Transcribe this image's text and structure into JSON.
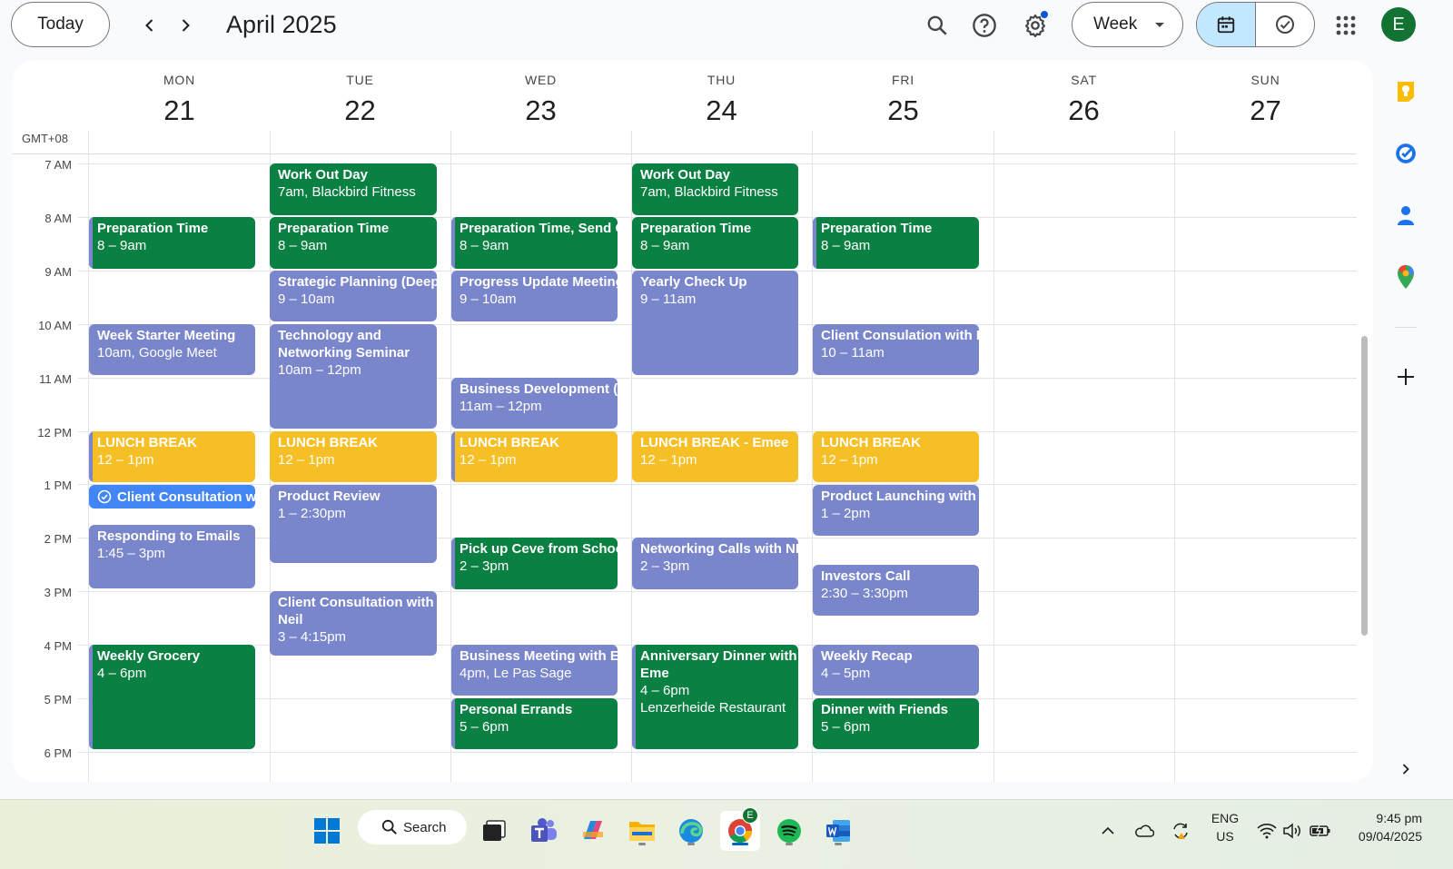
{
  "header": {
    "today_label": "Today",
    "month_title": "April 2025",
    "view_label": "Week",
    "avatar_initial": "E"
  },
  "calendar": {
    "timezone": "GMT+08",
    "days": [
      {
        "dow": "MON",
        "num": "21"
      },
      {
        "dow": "TUE",
        "num": "22"
      },
      {
        "dow": "WED",
        "num": "23"
      },
      {
        "dow": "THU",
        "num": "24"
      },
      {
        "dow": "FRI",
        "num": "25"
      },
      {
        "dow": "SAT",
        "num": "26"
      },
      {
        "dow": "SUN",
        "num": "27"
      }
    ],
    "hours": [
      "7 AM",
      "8 AM",
      "9 AM",
      "10 AM",
      "11 AM",
      "12 PM",
      "1 PM",
      "2 PM",
      "3 PM",
      "4 PM",
      "5 PM",
      "6 PM"
    ],
    "events": {
      "mon_prep": {
        "title": "Preparation Time",
        "time": "8 – 9am"
      },
      "mon_week_starter": {
        "title": "Week Starter Meeting",
        "time": "10am, Google Meet"
      },
      "mon_lunch": {
        "title": "LUNCH BREAK",
        "time": "12 – 1pm"
      },
      "mon_client_task": {
        "title": "Client Consultation with Lina"
      },
      "mon_emails": {
        "title": "Responding to Emails",
        "time": "1:45 – 3pm"
      },
      "mon_grocery": {
        "title": "Weekly Grocery",
        "time": "4 – 6pm"
      },
      "tue_workout": {
        "title": "Work Out Day",
        "time": "7am, Blackbird Fitness"
      },
      "tue_prep": {
        "title": "Preparation Time",
        "time": "8 – 9am"
      },
      "tue_strategic": {
        "title": "Strategic Planning (Deep Work)",
        "time": "9 – 10am"
      },
      "tue_tech": {
        "title": "Technology and Networking Seminar",
        "time": "10am – 12pm"
      },
      "tue_lunch": {
        "title": "LUNCH BREAK",
        "time": "12 – 1pm"
      },
      "tue_product_review": {
        "title": "Product Review",
        "time": "1 – 2:30pm"
      },
      "tue_client_neil": {
        "title": "Client Consultation with Neil",
        "time": "3 – 4:15pm"
      },
      "wed_prep": {
        "title": "Preparation Time, Send Client Update",
        "time": "8 – 9am"
      },
      "wed_progress": {
        "title": "Progress Update Meeting",
        "time": "9 – 10am"
      },
      "wed_bizdev": {
        "title": "Business Development (Deep Work)",
        "time": "11am – 12pm"
      },
      "wed_lunch": {
        "title": "LUNCH BREAK",
        "time": "12 – 1pm"
      },
      "wed_pickup": {
        "title": "Pick up Ceve from School",
        "time": "2 – 3pm"
      },
      "wed_biz_meeting": {
        "title": "Business Meeting with Emee",
        "time": "4pm, Le Pas Sage"
      },
      "wed_errands": {
        "title": "Personal Errands",
        "time": "5 – 6pm"
      },
      "thu_workout": {
        "title": "Work Out Day",
        "time": "7am, Blackbird Fitness"
      },
      "thu_prep": {
        "title": "Preparation Time",
        "time": "8 – 9am"
      },
      "thu_checkup": {
        "title": "Yearly Check Up",
        "time": "9 – 11am"
      },
      "thu_lunch": {
        "title": "LUNCH BREAK - Emee",
        "time": "12 – 1pm"
      },
      "thu_networking": {
        "title": "Networking Calls with NBA",
        "time": "2 – 3pm"
      },
      "thu_anniversary": {
        "title": "Anniversary Dinner with Eme",
        "time": "4 – 6pm",
        "location": "Lenzerheide Restaurant"
      },
      "fri_prep": {
        "title": "Preparation Time",
        "time": "8 – 9am"
      },
      "fri_client": {
        "title": "Client Consulation with Bea",
        "time": "10 – 11am"
      },
      "fri_lunch": {
        "title": "LUNCH BREAK",
        "time": "12 – 1pm"
      },
      "fri_launch": {
        "title": "Product Launching with Emee",
        "time": "1 – 2pm"
      },
      "fri_investors": {
        "title": "Investors Call",
        "time": "2:30 – 3:30pm"
      },
      "fri_recap": {
        "title": "Weekly Recap",
        "time": "4 – 5pm"
      },
      "fri_dinner": {
        "title": "Dinner with Friends",
        "time": "5 – 6pm"
      }
    }
  },
  "taskbar": {
    "search_label": "Search",
    "chrome_badge": "E",
    "lang_line1": "ENG",
    "lang_line2": "US",
    "time": "9:45 pm",
    "date": "09/04/2025"
  },
  "colors": {
    "green": "#0b8043",
    "lavender": "#7986cb",
    "banana": "#f6bf26",
    "blue": "#4285f4",
    "avatar": "#137333"
  }
}
